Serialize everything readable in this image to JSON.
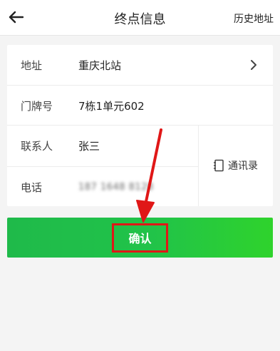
{
  "header": {
    "title": "终点信息",
    "history_label": "历史地址",
    "back_icon": "arrow-left-icon"
  },
  "form": {
    "address": {
      "label": "地址",
      "value": "重庆北站"
    },
    "door_number": {
      "label": "门牌号",
      "value": "7栋1单元602"
    },
    "contact": {
      "label": "联系人",
      "value": "张三"
    },
    "phone": {
      "label": "电话",
      "value": "187 1648 8128"
    },
    "contacts_book_label": "通讯录"
  },
  "confirm": {
    "label": "确认"
  },
  "colors": {
    "primary_green": "#21c349",
    "highlight_red": "#e01717"
  }
}
